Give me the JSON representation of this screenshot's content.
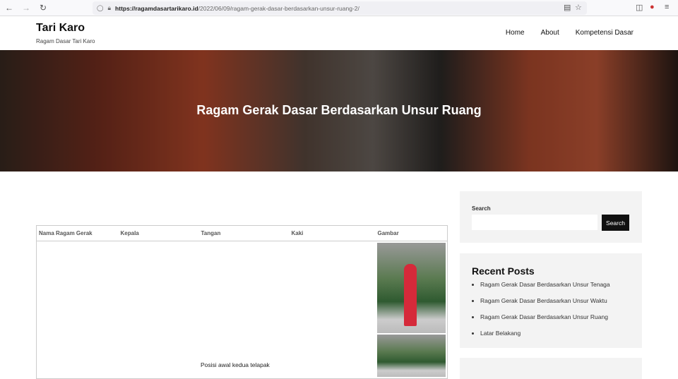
{
  "browser": {
    "url_host": "https://ragamdasartarikaro.id",
    "url_path": "/2022/06/09/ragam-gerak-dasar-berdasarkan-unsur-ruang-2/"
  },
  "site": {
    "title": "Tari Karo",
    "tagline": "Ragam Dasar Tari Karo"
  },
  "nav": [
    "Home",
    "About",
    "Kompetensi Dasar"
  ],
  "hero": {
    "title": "Ragam Gerak Dasar Berdasarkan Unsur Ruang"
  },
  "table": {
    "headers": [
      "Nama Ragam Gerak",
      "Kepala",
      "Tangan",
      "Kaki",
      "Gambar"
    ],
    "cell_text": "Posisi awal kedua telapak"
  },
  "sidebar": {
    "search_label": "Search",
    "search_button": "Search",
    "search_placeholder": "",
    "recent_title": "Recent Posts",
    "recent": [
      "Ragam Gerak Dasar Berdasarkan Unsur Tenaga",
      "Ragam Gerak Dasar Berdasarkan Unsur Waktu",
      "Ragam Gerak Dasar Berdasarkan Unsur Ruang",
      "Latar Belakang"
    ]
  }
}
